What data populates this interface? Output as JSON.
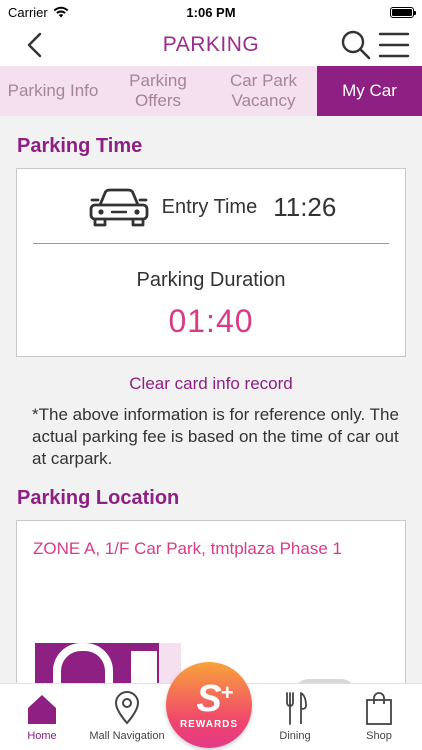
{
  "status": {
    "carrier": "Carrier",
    "time": "1:06 PM"
  },
  "header": {
    "title": "PARKING"
  },
  "tabs": [
    {
      "label": "Parking Info",
      "active": false
    },
    {
      "label": "Parking\nOffers",
      "active": false
    },
    {
      "label": "Car Park\nVacancy",
      "active": false
    },
    {
      "label": "My Car",
      "active": true
    }
  ],
  "parking_time": {
    "section_title": "Parking Time",
    "entry_label": "Entry Time",
    "entry_time": "11:26",
    "duration_label": "Parking Duration",
    "duration_value": "01:40"
  },
  "clear_link": "Clear card info record",
  "disclaimer": "*The above information is for reference only. The actual parking fee is based on the time of car out at carpark.",
  "parking_location": {
    "section_title": "Parking Location",
    "location": "ZONE A, 1/F Car Park, tmtplaza Phase 1"
  },
  "bottom_nav": {
    "home": "Home",
    "mall_navigation": "Mall Navigation",
    "rewards": "REWARDS",
    "dining": "Dining",
    "shop": "Shop"
  },
  "colors": {
    "brand": "#8e2084",
    "accent": "#d83c87",
    "tab_bg": "#f4e0ee"
  }
}
